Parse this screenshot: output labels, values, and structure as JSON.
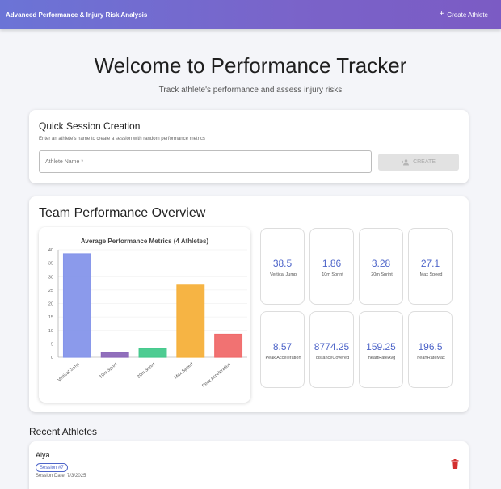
{
  "header": {
    "title": "Advanced Performance & Injury Risk Analysis",
    "create_label": "Create Athlete"
  },
  "hero": {
    "title": "Welcome to Performance Tracker",
    "subtitle": "Track athlete's performance and assess injury risks"
  },
  "quick": {
    "title": "Quick Session Creation",
    "description": "Enter an athlete's name to create a session with random performance metrics",
    "placeholder": "Athlete Name *",
    "button": "CREATE"
  },
  "overview": {
    "title": "Team Performance Overview",
    "metrics": [
      {
        "value": "38.5",
        "label": "Vertical Jump"
      },
      {
        "value": "1.86",
        "label": "10m Sprint"
      },
      {
        "value": "3.28",
        "label": "20m Sprint"
      },
      {
        "value": "27.1",
        "label": "Max Speed"
      },
      {
        "value": "8.57",
        "label": "Peak Acceleration"
      },
      {
        "value": "8774.25",
        "label": "distanceCovered"
      },
      {
        "value": "159.25",
        "label": "heartRateAvg"
      },
      {
        "value": "196.5",
        "label": "heartRateMax"
      }
    ]
  },
  "chart_data": {
    "type": "bar",
    "title": "Average Performance Metrics (4 Athletes)",
    "categories": [
      "Vertical Jump",
      "10m Sprint",
      "20m Sprint",
      "Max Speed",
      "Peak Acceleration"
    ],
    "values": [
      38.5,
      1.86,
      3.28,
      27.1,
      8.57
    ],
    "colors": [
      "#8595ea",
      "#8b67b8",
      "#45c98c",
      "#f6b03a",
      "#f06a6a"
    ],
    "ylim": [
      0,
      40
    ],
    "yticks": [
      0,
      5,
      10,
      15,
      20,
      25,
      30,
      35,
      40
    ],
    "grid": true
  },
  "recent": {
    "title": "Recent Athletes",
    "athletes": [
      {
        "name": "Alya",
        "session": "Session #7",
        "date": "Session Date: 7/3/2025"
      }
    ]
  },
  "colors": {
    "accent": "#4e65c9",
    "header_start": "#6b74d6",
    "header_end": "#7b5bc4",
    "delete": "#d32f2f"
  }
}
